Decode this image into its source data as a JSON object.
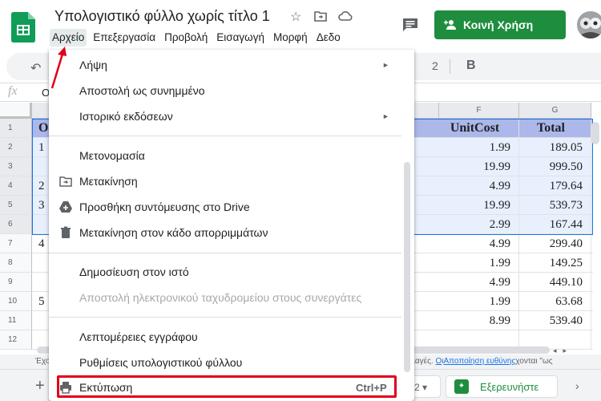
{
  "doc": {
    "title": "Υπολογιστικό φύλλο χωρίς τίτλο 1"
  },
  "menubar": [
    "Αρχείο",
    "Επεξεργασία",
    "Προβολή",
    "Εισαγωγή",
    "Μορφή",
    "Δεδο"
  ],
  "share": {
    "label": "Κοινή Χρήση"
  },
  "toolbar": {
    "font_size": "2"
  },
  "formula": {
    "value": "O"
  },
  "grid": {
    "col_headers": [
      "F",
      "G"
    ],
    "row_numbers": [
      "1",
      "2",
      "3",
      "4",
      "5",
      "6",
      "7",
      "8",
      "9",
      "10",
      "11",
      "12"
    ],
    "header_row": {
      "left": "O",
      "unitcost": "UnitCost",
      "total": "Total"
    },
    "left_fragments": [
      "",
      "1",
      "",
      "2",
      "3",
      "",
      "4",
      "",
      "",
      "5",
      "",
      ""
    ],
    "unitcost": [
      "1.99",
      "19.99",
      "4.99",
      "19.99",
      "2.99",
      "4.99",
      "1.99",
      "4.99",
      "1.99",
      "8.99"
    ],
    "total": [
      "189.05",
      "999.50",
      "179.64",
      "539.73",
      "167.44",
      "299.40",
      "149.25",
      "449.10",
      "63.68",
      "539.40"
    ]
  },
  "status": {
    "left": "Έχο",
    "right_prefix": "λλαγές. ",
    "right_link": "Ο",
    "right_mid": "ι",
    "right_link2": "Αποποίηση ευθύνης",
    "right_suffix": "χονται \"ως"
  },
  "bottom": {
    "add_sheet": "+",
    "zoom_value": "2",
    "explore_label": "Εξερευνήστε"
  },
  "menu": {
    "items": [
      {
        "label": "Λήψη",
        "arrow": "►"
      },
      {
        "label": "Αποστολή ως συνημμένο"
      },
      {
        "label": "Ιστορικό εκδόσεων",
        "arrow": "►"
      },
      {
        "label": "Μετονομασία"
      },
      {
        "label": "Μετακίνηση"
      },
      {
        "label": "Προσθήκη συντόμευσης στο Drive"
      },
      {
        "label": "Μετακίνηση στον κάδο απορριμμάτων"
      },
      {
        "label": "Δημοσίευση στον ιστό"
      },
      {
        "label": "Αποστολή ηλεκτρονικού ταχυδρομείου στους συνεργάτες"
      },
      {
        "label": "Λεπτομέρειες εγγράφου"
      },
      {
        "label": "Ρυθμίσεις υπολογιστικού φύλλου"
      },
      {
        "label": "Εκτύπωση",
        "shortcut": "Ctrl+P"
      }
    ]
  },
  "colors": {
    "share_green": "#1e8e3e",
    "header_row": "#acb7ea",
    "selection_fill": "#e8f0fe",
    "highlight_red": "#e0001b"
  }
}
